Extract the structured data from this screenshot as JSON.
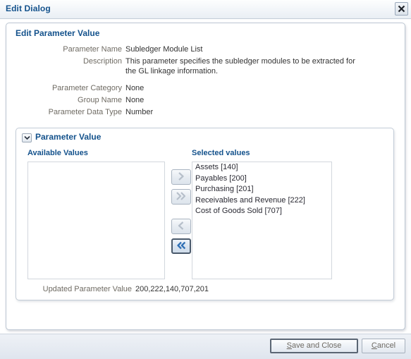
{
  "window": {
    "title": "Edit Dialog",
    "close_icon": "close-x-icon"
  },
  "panel": {
    "heading": "Edit Parameter Value"
  },
  "details": [
    {
      "label": "Parameter Name",
      "value": "Subledger Module List"
    },
    {
      "label": "Description",
      "value": "This parameter specifies the subledger modules to be extracted for the GL linkage information."
    },
    {
      "label": "Parameter Category",
      "value": "None"
    },
    {
      "label": "Group Name",
      "value": "None"
    },
    {
      "label": "Parameter Data Type",
      "value": "Number"
    }
  ],
  "parameter_value": {
    "section_title": "Parameter Value",
    "disclosure_icon": "chevron-down-icon",
    "available_label": "Available Values",
    "selected_label": "Selected values",
    "available_items": [],
    "selected_items": [
      "Assets [140]",
      "Payables [200]",
      "Purchasing [201]",
      "Receivables and Revenue [222]",
      "Cost of Goods Sold [707]"
    ],
    "shuttle": {
      "move_right_icon": "chevron-right-icon",
      "move_all_right_icon": "chevron-double-right-icon",
      "move_left_icon": "chevron-left-icon",
      "move_all_left_icon": "chevron-double-left-icon"
    },
    "updated_label": "Updated Parameter Value",
    "updated_value": "200,222,140,707,201"
  },
  "footer": {
    "save_label": "Save and Close",
    "cancel_label": "Cancel"
  },
  "colors": {
    "heading": "#14528c",
    "label": "#6f6b63",
    "value": "#333333",
    "enabled_arrow": "#2f6fb5",
    "disabled_arrow": "#b6bfca"
  }
}
